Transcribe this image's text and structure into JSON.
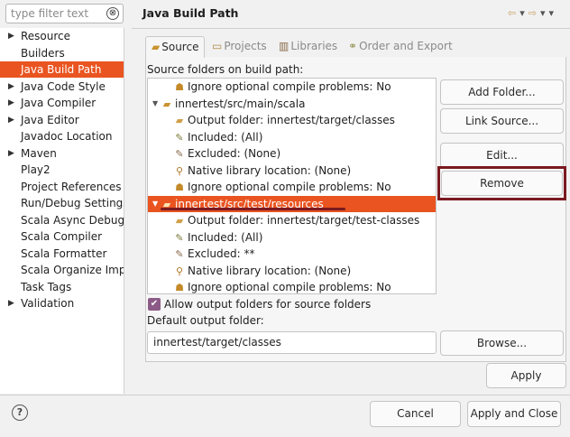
{
  "filter": {
    "placeholder": "type filter text",
    "clear_icon": "⊗"
  },
  "nav": [
    {
      "label": "Resource",
      "arrow": "▶"
    },
    {
      "label": "Builders",
      "arrow": ""
    },
    {
      "label": "Java Build Path",
      "arrow": "",
      "selected": true
    },
    {
      "label": "Java Code Style",
      "arrow": "▶"
    },
    {
      "label": "Java Compiler",
      "arrow": "▶"
    },
    {
      "label": "Java Editor",
      "arrow": "▶"
    },
    {
      "label": "Javadoc Location",
      "arrow": ""
    },
    {
      "label": "Maven",
      "arrow": "▶"
    },
    {
      "label": "Play2",
      "arrow": ""
    },
    {
      "label": "Project References",
      "arrow": ""
    },
    {
      "label": "Run/Debug Settings",
      "arrow": ""
    },
    {
      "label": "Scala Async Debugger",
      "arrow": ""
    },
    {
      "label": "Scala Compiler",
      "arrow": ""
    },
    {
      "label": "Scala Formatter",
      "arrow": ""
    },
    {
      "label": "Scala Organize Imports",
      "arrow": ""
    },
    {
      "label": "Task Tags",
      "arrow": ""
    },
    {
      "label": "Validation",
      "arrow": "▶"
    }
  ],
  "page": {
    "title": "Java Build Path"
  },
  "tabs": [
    {
      "label": "Source",
      "icon": "source-folder-icon",
      "active": true
    },
    {
      "label": "Projects",
      "icon": "projects-icon"
    },
    {
      "label": "Libraries",
      "icon": "libraries-icon"
    },
    {
      "label": "Order and Export",
      "icon": "order-export-icon"
    }
  ],
  "source": {
    "heading": "Source folders on build path:",
    "rows": [
      {
        "text": "Ignore optional compile problems: No",
        "icon": "ignore-icon"
      },
      {
        "text": "innertest/src/main/scala",
        "icon": "package-folder-icon",
        "twisty": "▼"
      },
      {
        "text": "Output folder: innertest/target/classes",
        "icon": "output-folder-icon"
      },
      {
        "text": "Included: (All)",
        "icon": "included-icon"
      },
      {
        "text": "Excluded: (None)",
        "icon": "excluded-icon"
      },
      {
        "text": "Native library location: (None)",
        "icon": "native-library-icon"
      },
      {
        "text": "Ignore optional compile problems: No",
        "icon": "ignore-icon"
      },
      {
        "text": "innertest/src/test/resources",
        "icon": "package-folder-icon",
        "twisty": "▼",
        "selected": true
      },
      {
        "text": "Output folder: innertest/target/test-classes",
        "icon": "output-folder-icon"
      },
      {
        "text": "Included: (All)",
        "icon": "included-icon"
      },
      {
        "text": "Excluded: **",
        "icon": "excluded-icon"
      },
      {
        "text": "Native library location: (None)",
        "icon": "native-library-icon"
      },
      {
        "text": "Ignore optional compile problems: No",
        "icon": "ignore-icon"
      }
    ]
  },
  "buttons": {
    "add_folder": "Add Folder...",
    "link_source": "Link Source...",
    "edit": "Edit...",
    "remove": "Remove",
    "browse": "Browse...",
    "apply": "Apply",
    "cancel": "Cancel",
    "apply_close": "Apply and Close"
  },
  "allow_output": {
    "label": "Allow output folders for source folders",
    "checked": true
  },
  "default_output": {
    "label": "Default output folder:",
    "value": "innertest/target/classes"
  },
  "colors": {
    "selection": "#e95420",
    "highlight_frame": "#7a1a20"
  }
}
